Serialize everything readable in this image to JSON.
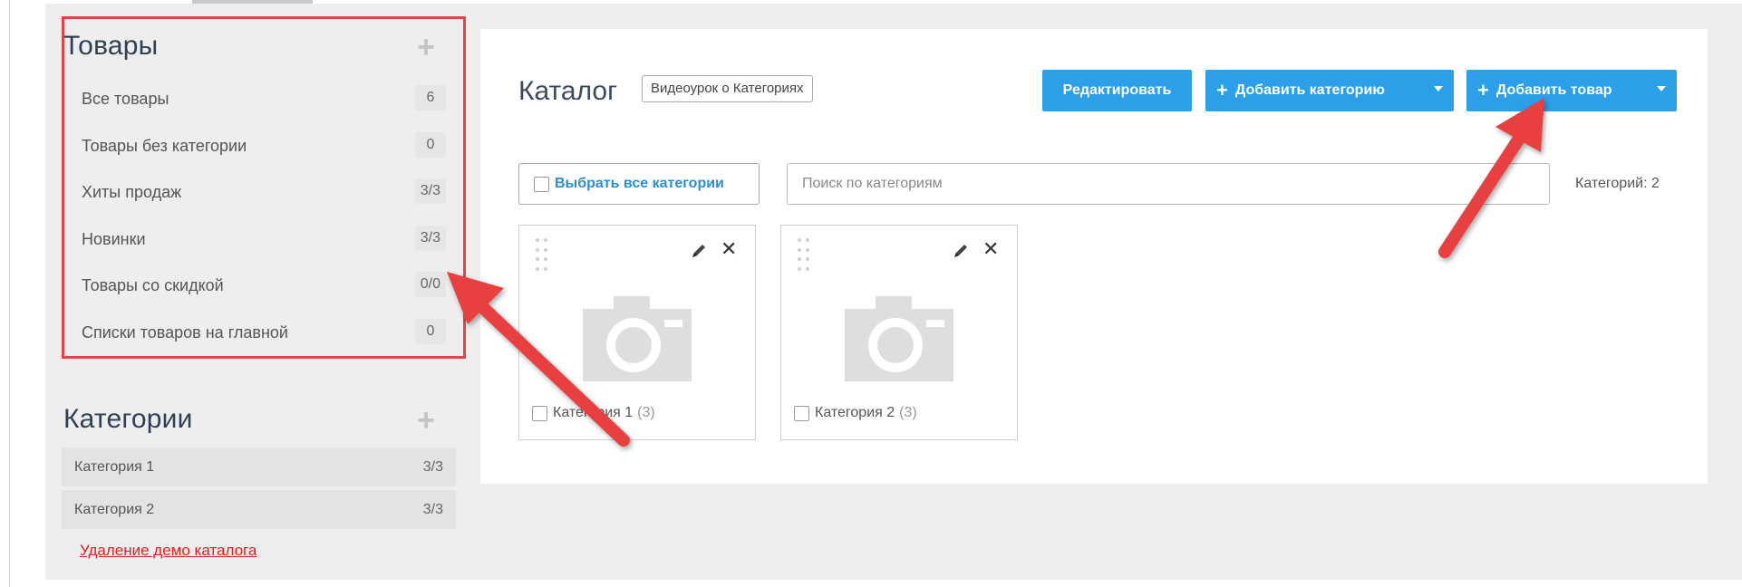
{
  "sidebar": {
    "goods_title": "Товары",
    "goods_items": [
      {
        "label": "Все товары",
        "badge": "6"
      },
      {
        "label": "Товары без категории",
        "badge": "0"
      },
      {
        "label": "Хиты продаж",
        "badge": "3/3"
      },
      {
        "label": "Новинки",
        "badge": "3/3"
      },
      {
        "label": "Товары со скидкой",
        "badge": "0/0"
      },
      {
        "label": "Списки товаров на главной",
        "badge": "0"
      }
    ],
    "categories_title": "Категории",
    "categories": [
      {
        "label": "Категория 1",
        "count": "3/3"
      },
      {
        "label": "Категория 2",
        "count": "3/3"
      }
    ],
    "demo_link": "Удаление демо каталога"
  },
  "main": {
    "title": "Каталог",
    "video_button": "Видеоурок о Категориях",
    "edit_button": "Редактировать",
    "add_category_button": "Добавить категорию",
    "add_goods_button": "Добавить товар",
    "select_all_label": "Выбрать все категории",
    "search_placeholder": "Поиск по категориям",
    "categories_count": "Категорий: 2",
    "cards": [
      {
        "label": "Категория 1",
        "count": "(3)"
      },
      {
        "label": "Категория 2",
        "count": "(3)"
      }
    ]
  },
  "colors": {
    "accent": "#2d9ee8",
    "highlight_box": "#e04646",
    "arrow": "#e8403f",
    "link": "#e02020"
  },
  "icons": [
    "plus-icon",
    "pencil-icon",
    "close-icon",
    "camera-icon",
    "drag-handle-icon",
    "caret-down-icon",
    "arrow-annotation"
  ]
}
